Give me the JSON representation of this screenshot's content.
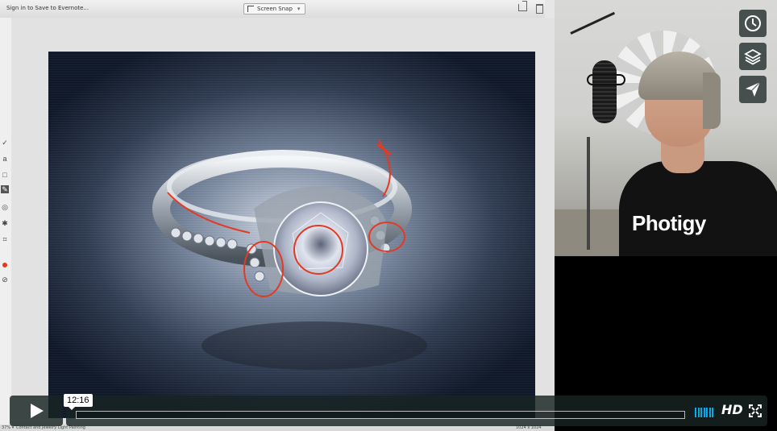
{
  "app": {
    "sign_in_label": "Sign in to Save to Evernote...",
    "screen_snap_label": "Screen Snap",
    "status_zoom": "37% ▾",
    "status_filename": "Contact and Jewelry Light Painting",
    "status_dims": "1024 x 1024"
  },
  "webcam": {
    "shirt_logo": "Photigy"
  },
  "side_buttons": [
    {
      "icon": "clock-icon"
    },
    {
      "icon": "layers-icon"
    },
    {
      "icon": "send-icon"
    }
  ],
  "player": {
    "timecode": "12:16",
    "hd_label": "HD",
    "accent_color": "#00adef",
    "progress_fraction": 0.0
  }
}
